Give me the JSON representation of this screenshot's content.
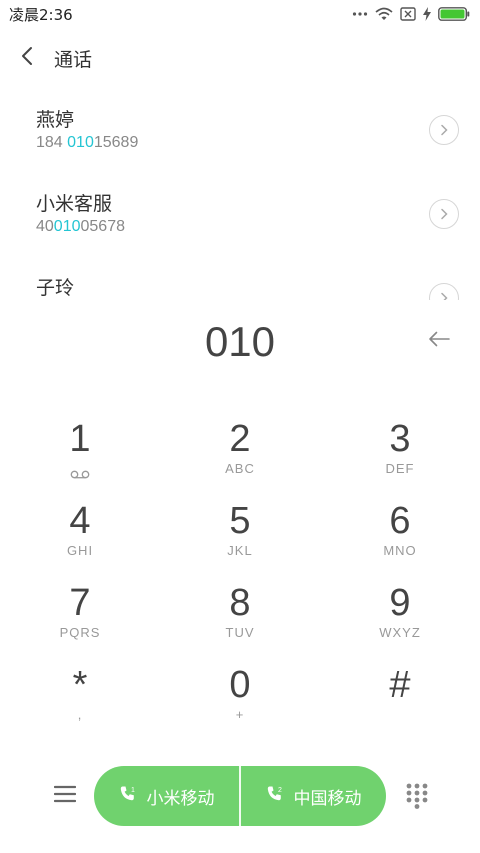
{
  "status_bar": {
    "time": "凌晨2:36",
    "icons": [
      "more-dots-icon",
      "wifi-icon",
      "no-sim-icon",
      "charging-icon",
      "battery-icon"
    ],
    "battery_color": "#44c733"
  },
  "header": {
    "title": "通话",
    "back_icon": "chevron-left-icon"
  },
  "contacts": [
    {
      "name": "燕婷",
      "number_pre": "184 ",
      "number_match": "010",
      "number_post": "15689"
    },
    {
      "name": "小米客服",
      "number_pre": "40",
      "number_match": "010",
      "number_post": "05678"
    },
    {
      "name": "子玲",
      "number_pre": "",
      "number_match": "",
      "number_post": ""
    }
  ],
  "dialer": {
    "input": "010",
    "backspace_icon": "arrow-left-icon"
  },
  "keypad": [
    {
      "digit": "1",
      "letters": "",
      "sub_icon": "voicemail-icon"
    },
    {
      "digit": "2",
      "letters": "ABC"
    },
    {
      "digit": "3",
      "letters": "DEF"
    },
    {
      "digit": "4",
      "letters": "GHI"
    },
    {
      "digit": "5",
      "letters": "JKL"
    },
    {
      "digit": "6",
      "letters": "MNO"
    },
    {
      "digit": "7",
      "letters": "PQRS"
    },
    {
      "digit": "8",
      "letters": "TUV"
    },
    {
      "digit": "9",
      "letters": "WXYZ"
    },
    {
      "digit": "*",
      "letters": ","
    },
    {
      "digit": "0",
      "letters": "+"
    },
    {
      "digit": "#",
      "letters": ""
    }
  ],
  "bottom_bar": {
    "menu_icon": "menu-icon",
    "sim1_label": "小米移动",
    "sim2_label": "中国移动",
    "sim1_icon": "phone-sim1-icon",
    "sim2_icon": "phone-sim2-icon",
    "keypad_icon": "dialpad-icon",
    "call_color": "#70d26e"
  }
}
